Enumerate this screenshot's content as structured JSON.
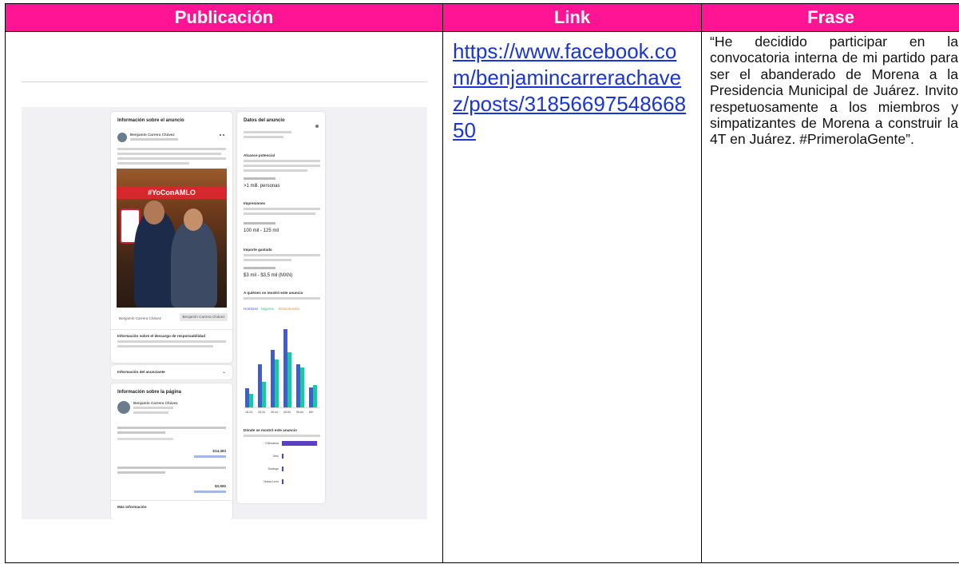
{
  "table": {
    "headers": [
      "Publicación",
      "Link",
      "Frase"
    ],
    "link": "https://www.facebook.com/benjamincarrerachavez/posts/3185669754866850",
    "frase": "“He decidido participar en la convocatoria interna de mi partido para ser el abanderado de Morena a la Presidencia Municipal de Juárez. Invito respetuosamente a los miembros y simpatizantes de Morena a construir la 4T en Juárez. #PrimerolaGente”."
  },
  "screenshot": {
    "ad_info": {
      "title": "Información sobre el anuncio",
      "author": "Benjamín Carrera Chávez",
      "banner": "#YoConAMLO",
      "photo_caption": "Benjamín Carrera Chávez",
      "photo_button": "Benjamín Carrera Chávez",
      "disclaimer_title": "Información sobre el descargo de responsabilidad",
      "advertiser_title": "Información del anunciante"
    },
    "page_info": {
      "title": "Información sobre la página",
      "page_name": "Benjamín Carrera Chávez",
      "spend_total": "$14.493",
      "spend_recent": "$3.500",
      "more_info": "Más información"
    },
    "ad_data": {
      "title": "Datos del anuncio",
      "potential_reach": "Alcance potencial",
      "reach_value": ">1 mill. personas",
      "impressions_title": "Impresiones",
      "impressions_value": "100 mil - 125 mil",
      "spend_title": "Importe gastado",
      "spend_value": "$3 mil - $3,5 mil (MXN)",
      "audience_title": "A quiénes se mostró este anuncio",
      "legend": [
        "Hombres",
        "Mujeres",
        "Desconocido"
      ],
      "where_title": "Dónde se mostró este anuncio"
    }
  },
  "chart_data": {
    "type": "bar",
    "categories": [
      "18-24",
      "25-34",
      "35-44",
      "45-54",
      "55-64",
      "65+"
    ],
    "series": [
      {
        "name": "Hombres",
        "values": [
          7.5,
          17,
          23,
          31,
          17,
          8
        ]
      },
      {
        "name": "Mujeres",
        "values": [
          5.5,
          10,
          19,
          22,
          16,
          9
        ]
      }
    ],
    "ylim": [
      0,
      33
    ],
    "horizontal": {
      "categories": [
        "Chihuahua",
        "Ohio",
        "Durango",
        "Nuevo León"
      ],
      "values": [
        88,
        1,
        1,
        1
      ]
    }
  }
}
